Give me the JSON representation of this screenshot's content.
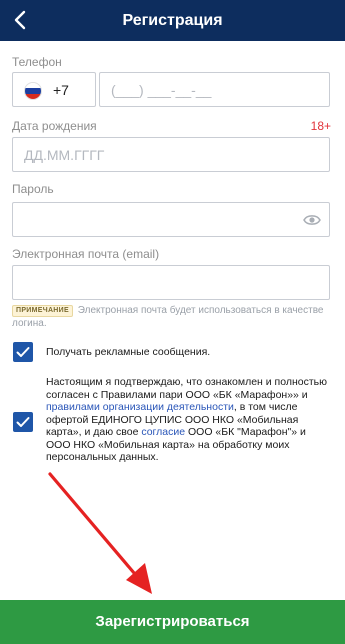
{
  "header": {
    "title": "Регистрация",
    "back_icon": "chevron-left-icon"
  },
  "phone": {
    "label": "Телефон",
    "country_code": "+7",
    "flag": [
      "#ffffff",
      "#1c3fa0",
      "#d52b1e"
    ],
    "placeholder": "(___) ___-__-__"
  },
  "birthdate": {
    "label": "Дата рождения",
    "age_limit": "18+",
    "placeholder": "ДД.ММ.ГГГГ"
  },
  "password": {
    "label": "Пароль",
    "value": "",
    "eye_icon": "eye-icon"
  },
  "email": {
    "label": "Электронная почта (email)",
    "value": "",
    "note_badge": "ПРИМЕЧАНИЕ",
    "note": "Электронная почта будет использоваться в качестве логина."
  },
  "consents": {
    "ads": {
      "checked": true,
      "text": "Получать рекламные сообщения."
    },
    "agreement": {
      "checked": true,
      "part1": "Настоящим я подтверждаю, что ознакомлен и полностью согласен с Правилами пари ООО «БК «Марафон»» и ",
      "link1": "правилами организации деятельности",
      "part2": ", в том числе офертой ЕДИНОГО ЦУПИС ООО НКО «Мобильная карта», и даю свое ",
      "link2": "согласие",
      "part3": " ООО «БК \"Марафон\"» и ООО НКО «Мобильная карта» на обработку моих персональных данных."
    }
  },
  "submit": {
    "label": "Зарегистрироваться"
  },
  "colors": {
    "header": "#0d2d5e",
    "button": "#2e9a43",
    "checkbox": "#1f56a8",
    "age": "#e2333a",
    "arrow": "#e52222"
  }
}
